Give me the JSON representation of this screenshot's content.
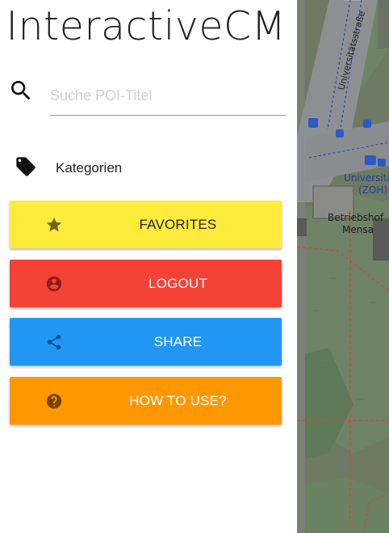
{
  "app": {
    "title": "InteractiveCM"
  },
  "search": {
    "placeholder": "Suche POI-Titel",
    "value": ""
  },
  "categories": {
    "label": "Kategorien",
    "icon": "tag-icon"
  },
  "buttons": [
    {
      "id": "favorites",
      "label": "FAVORITES",
      "icon": "star-icon",
      "bg": "#ffeb3b",
      "fg": "#222222",
      "icon_color": "#6d6220"
    },
    {
      "id": "logout",
      "label": "LOGOUT",
      "icon": "account-circle-icon",
      "bg": "#f44336",
      "fg": "#ffffff",
      "icon_color": "#8a1f17"
    },
    {
      "id": "share",
      "label": "SHARE",
      "icon": "share-icon",
      "bg": "#2196f3",
      "fg": "#ffffff",
      "icon_color": "#0d4f8a"
    },
    {
      "id": "how-to-use",
      "label": "HOW TO USE?",
      "icon": "help-icon",
      "bg": "#ff9800",
      "fg": "#ffffff",
      "icon_color": "#7a4200"
    }
  ],
  "map": {
    "street": "Universitätsstraße",
    "stop_line1": "Universität",
    "stop_line2": "(ZOH)",
    "building_line1": "Betriebshof",
    "building_line2": "Mensa"
  }
}
